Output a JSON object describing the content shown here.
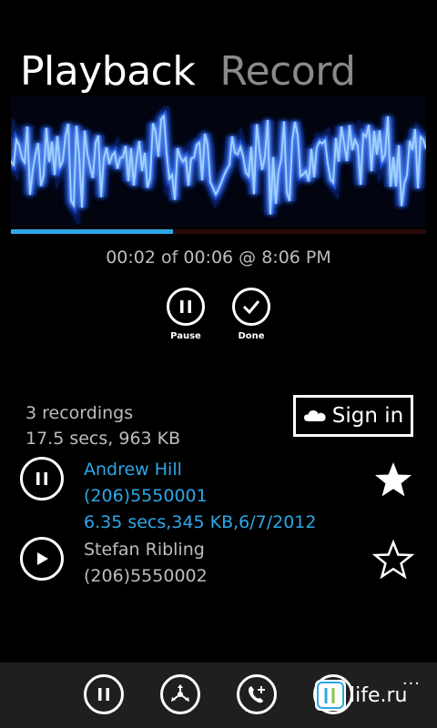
{
  "pivot": {
    "active": "Playback",
    "inactive": "Record"
  },
  "player": {
    "progress_fraction": 0.39,
    "time_text": "00:02 of 00:06 @ 8:06 PM",
    "pause_label": "Pause",
    "done_label": "Done"
  },
  "summary": {
    "count": "3 recordings",
    "total": "17.5 secs, 963 KB"
  },
  "signin": {
    "label": "Sign in"
  },
  "recordings": [
    {
      "name": "Andrew Hill",
      "phone": "(206)5550001",
      "details": "6.35 secs,345 KB,6/7/2012",
      "playing": true,
      "favorite": true,
      "color": "#2ea7e6"
    },
    {
      "name": "Stefan Ribling",
      "phone": "(206)5550002",
      "playing": false,
      "favorite": false,
      "color": "#bdbdbd"
    }
  ],
  "appbar": {
    "buttons": [
      "pause-icon",
      "share-icon",
      "call-add-icon",
      "edit-icon"
    ],
    "more": "..."
  },
  "watermark": {
    "text": "life.ru"
  },
  "colors": {
    "accent": "#2ea7e6",
    "background": "#000000",
    "appbar": "#1f1f1f"
  }
}
